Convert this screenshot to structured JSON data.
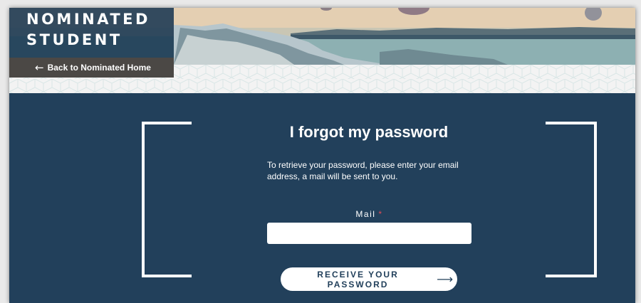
{
  "header": {
    "brand_line1": "NOMINATED",
    "brand_line2": "STUDENT",
    "back_link": "Back to Nominated Home",
    "back_icon": "arrow-left-icon"
  },
  "form": {
    "title": "I forgot my password",
    "description": "To retrieve your password, please enter your email address, a mail will be sent to you.",
    "mail_label": "Mail",
    "required_marker": "*",
    "mail_value": "",
    "submit_label": "RECEIVE YOUR PASSWORD",
    "submit_icon": "arrow-right-icon"
  },
  "colors": {
    "panel_bg": "#22405b",
    "brand_bg": "#1a3852",
    "back_bg": "#4b4845",
    "required": "#e14b57"
  }
}
